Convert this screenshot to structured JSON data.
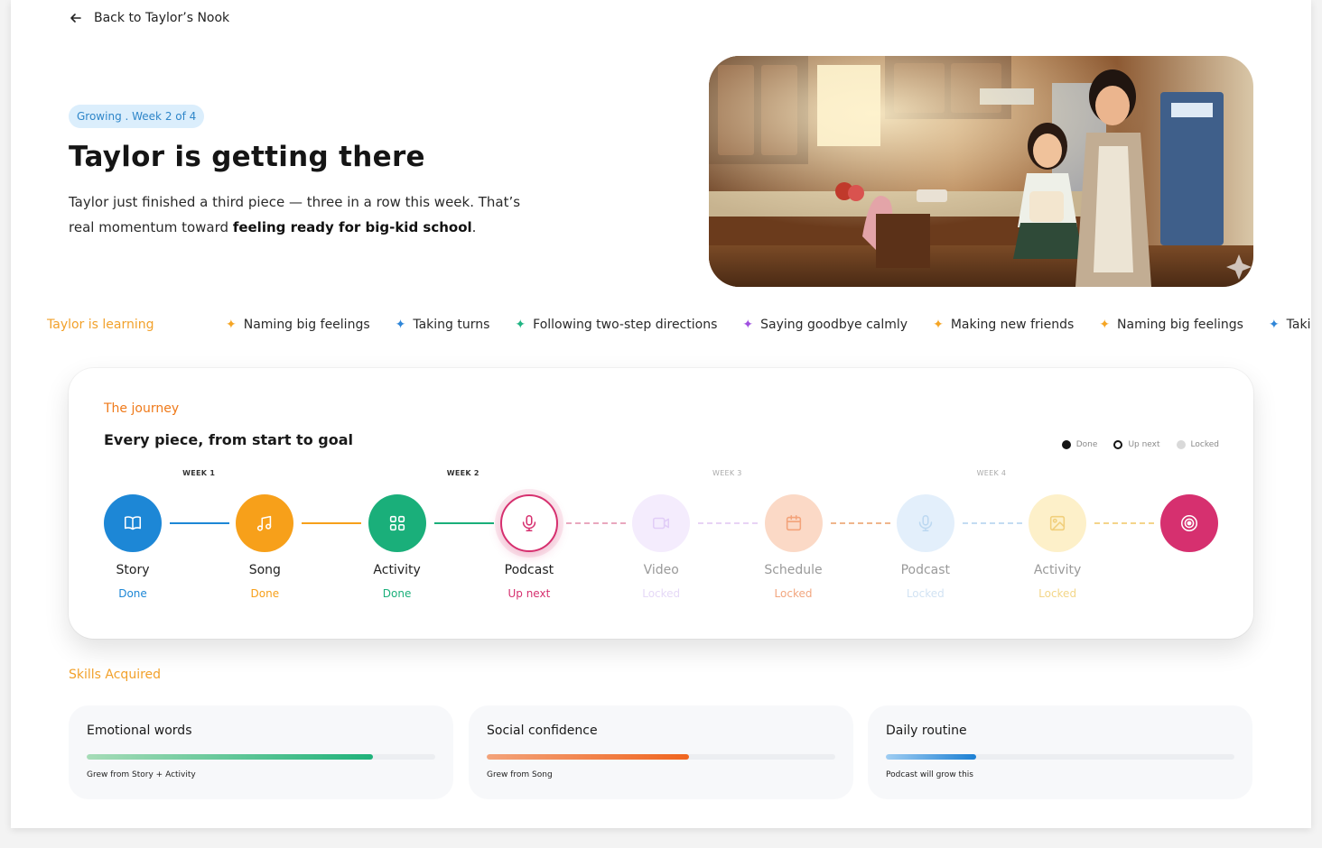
{
  "back": {
    "label": "Back to Taylor’s Nook"
  },
  "hero": {
    "pill": "Growing . Week 2 of 4",
    "title": "Taylor is getting there",
    "desc_start": "Taylor just finished a third piece — three in a row this week. That’s real momentum toward ",
    "desc_bold": "feeling ready for big-kid school",
    "desc_end": "."
  },
  "learning": {
    "label": "Taylor is learning",
    "items": [
      {
        "label": "Naming big feelings",
        "color": "#f5a524"
      },
      {
        "label": "Taking turns",
        "color": "#2f86d8"
      },
      {
        "label": "Following two-step directions",
        "color": "#20b483"
      },
      {
        "label": "Saying goodbye calmly",
        "color": "#a050e0"
      },
      {
        "label": "Making new friends",
        "color": "#f5a524"
      },
      {
        "label": "Naming big feelings",
        "color": "#f5a524"
      },
      {
        "label": "Taking turns",
        "color": "#2f86d8"
      }
    ]
  },
  "journey": {
    "eyebrow": "The journey",
    "title": "Every piece, from start to goal",
    "legend": {
      "done": "Done",
      "upnext": "Up next",
      "locked": "Locked"
    },
    "weeks": [
      "WEEK 1",
      "WEEK 2",
      "WEEK 3",
      "WEEK 4"
    ],
    "nodes": [
      {
        "label": "Story",
        "status": "Done",
        "icon": "book-icon"
      },
      {
        "label": "Song",
        "status": "Done",
        "icon": "music-icon"
      },
      {
        "label": "Activity",
        "status": "Done",
        "icon": "grid-icon"
      },
      {
        "label": "Podcast",
        "status": "Up next",
        "icon": "mic-icon"
      },
      {
        "label": "Video",
        "status": "Locked",
        "icon": "video-icon"
      },
      {
        "label": "Schedule",
        "status": "Locked",
        "icon": "calendar-icon"
      },
      {
        "label": "Podcast",
        "status": "Locked",
        "icon": "mic-icon"
      },
      {
        "label": "Activity",
        "status": "Locked",
        "icon": "image-icon"
      }
    ],
    "goal_icon": "target-icon"
  },
  "skills": {
    "label": "Skills Acquired",
    "items": [
      {
        "title": "Emotional words",
        "note": "Grew from Story + Activity",
        "progress": 0.82
      },
      {
        "title": "Social confidence",
        "note": "Grew from Song",
        "progress": 0.58
      },
      {
        "title": "Daily routine",
        "note": "Podcast will grow this",
        "progress": 0.26
      }
    ]
  },
  "colors": {
    "blue": "#1d87d6",
    "orange": "#f7a01a",
    "green": "#1aaf7a",
    "pink": "#d6306f",
    "violet": "#c89cf0",
    "peach": "#f7b38a",
    "sky": "#a9cfee",
    "butter": "#f5d27c"
  }
}
